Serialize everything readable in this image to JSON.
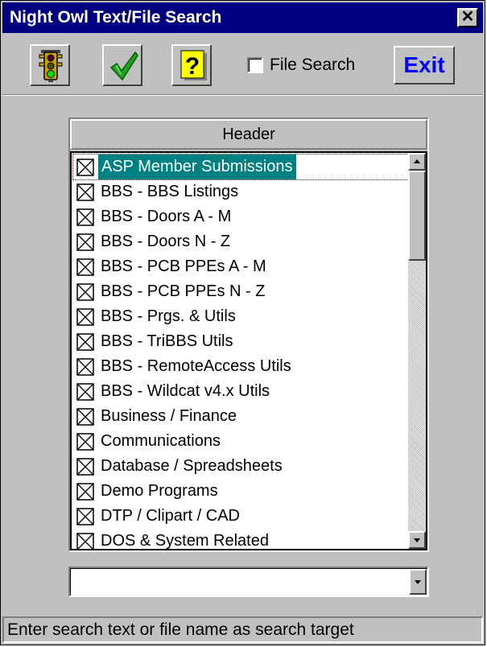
{
  "window": {
    "title": "Night Owl Text/File Search",
    "close_label": "✕"
  },
  "toolbar": {
    "file_search_label": "File Search",
    "file_search_checked": false,
    "exit_label": "Exit"
  },
  "list": {
    "header": "Header",
    "items": [
      {
        "label": "ASP Member Submissions",
        "checked": true,
        "selected": true
      },
      {
        "label": "BBS - BBS Listings",
        "checked": true
      },
      {
        "label": "BBS - Doors A - M",
        "checked": true
      },
      {
        "label": "BBS - Doors N - Z",
        "checked": true
      },
      {
        "label": "BBS - PCB PPEs A - M",
        "checked": true
      },
      {
        "label": "BBS - PCB PPEs N - Z",
        "checked": true
      },
      {
        "label": "BBS - Prgs. & Utils",
        "checked": true
      },
      {
        "label": "BBS - TriBBS Utils",
        "checked": true
      },
      {
        "label": "BBS - RemoteAccess Utils",
        "checked": true
      },
      {
        "label": "BBS - Wildcat v4.x Utils",
        "checked": true
      },
      {
        "label": "Business / Finance",
        "checked": true
      },
      {
        "label": "Communications",
        "checked": true
      },
      {
        "label": "Database / Spreadsheets",
        "checked": true
      },
      {
        "label": "Demo Programs",
        "checked": true
      },
      {
        "label": "DTP / Clipart / CAD",
        "checked": true
      },
      {
        "label": "DOS & System Related",
        "checked": true
      }
    ]
  },
  "search_combo": {
    "value": ""
  },
  "status_bar": {
    "text": "Enter search text or file name as search target"
  },
  "colors": {
    "titlebar": "#000080",
    "selection": "#008080",
    "exit_text": "#0000ff"
  }
}
